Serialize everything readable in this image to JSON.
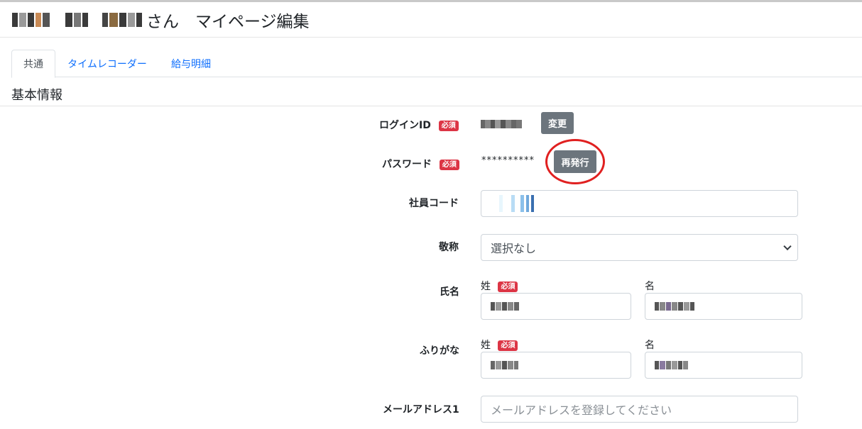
{
  "header": {
    "title_suffix": "さん　マイページ編集"
  },
  "tabs": [
    {
      "label": "共通",
      "active": true
    },
    {
      "label": "タイムレコーダー",
      "active": false
    },
    {
      "label": "給与明細",
      "active": false
    }
  ],
  "section": {
    "title": "基本情報"
  },
  "form": {
    "login_id": {
      "label": "ログインID",
      "required_badge": "必須",
      "change_button": "変更"
    },
    "password": {
      "label": "パスワード",
      "required_badge": "必須",
      "value": "**********",
      "reissue_button": "再発行"
    },
    "employee_code": {
      "label": "社員コード"
    },
    "honorific": {
      "label": "敬称",
      "selected": "選択なし"
    },
    "name": {
      "label": "氏名",
      "last_label": "姓",
      "first_label": "名",
      "required_badge": "必須"
    },
    "furigana": {
      "label": "ふりがな",
      "last_label": "姓",
      "first_label": "名",
      "required_badge": "必須"
    },
    "email1": {
      "label": "メールアドレス1",
      "placeholder": "メールアドレスを登録してください"
    }
  },
  "colors": {
    "link": "#0d6efd",
    "badge": "#dc3545",
    "button": "#6c757d",
    "highlight": "#e02020"
  }
}
